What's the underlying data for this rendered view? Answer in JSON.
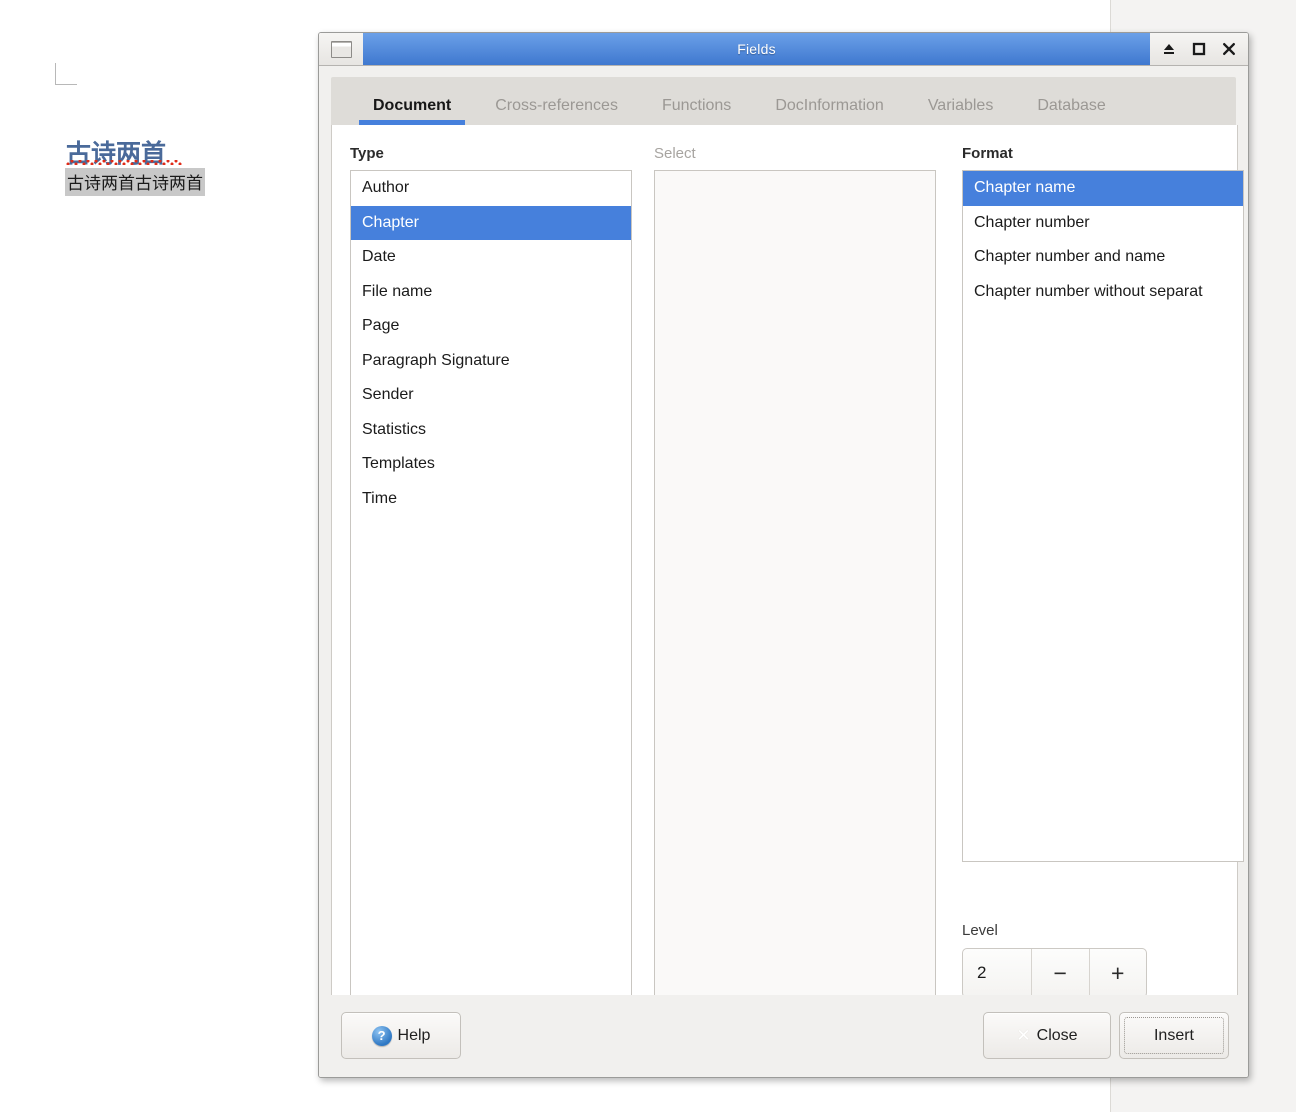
{
  "document": {
    "heading": "古诗两首",
    "body_text": "古诗两首古诗两首"
  },
  "dialog": {
    "title": "Fields",
    "titlebar_icons": {
      "window_icon": "window-restore-icon",
      "shade": "eject-icon",
      "maximize": "maximize-icon",
      "close": "close-icon"
    },
    "tabs": [
      {
        "label": "Document",
        "active": true
      },
      {
        "label": "Cross-references",
        "active": false
      },
      {
        "label": "Functions",
        "active": false
      },
      {
        "label": "DocInformation",
        "active": false
      },
      {
        "label": "Variables",
        "active": false
      },
      {
        "label": "Database",
        "active": false
      }
    ],
    "type": {
      "label": "Type",
      "items": [
        "Author",
        "Chapter",
        "Date",
        "File name",
        "Page",
        "Paragraph Signature",
        "Sender",
        "Statistics",
        "Templates",
        "Time"
      ],
      "selected": "Chapter"
    },
    "select": {
      "label": "Select",
      "items": [],
      "disabled": true
    },
    "format": {
      "label": "Format",
      "items": [
        "Chapter name",
        "Chapter number",
        "Chapter number and name",
        "Chapter number without separat"
      ],
      "selected": "Chapter name"
    },
    "level": {
      "label": "Level",
      "value": "2",
      "minus_label": "−",
      "plus_label": "+"
    },
    "buttons": {
      "help": "Help",
      "close": "Close",
      "insert": "Insert"
    },
    "colors": {
      "selection_blue": "#4680dc",
      "titlebar_blue": "#3f78cf",
      "tab_underline": "#4680dc",
      "heading_blue": "#4a6a9a",
      "spellcheck_red": "#e02b18",
      "field_shading": "#c8c8c8"
    }
  }
}
